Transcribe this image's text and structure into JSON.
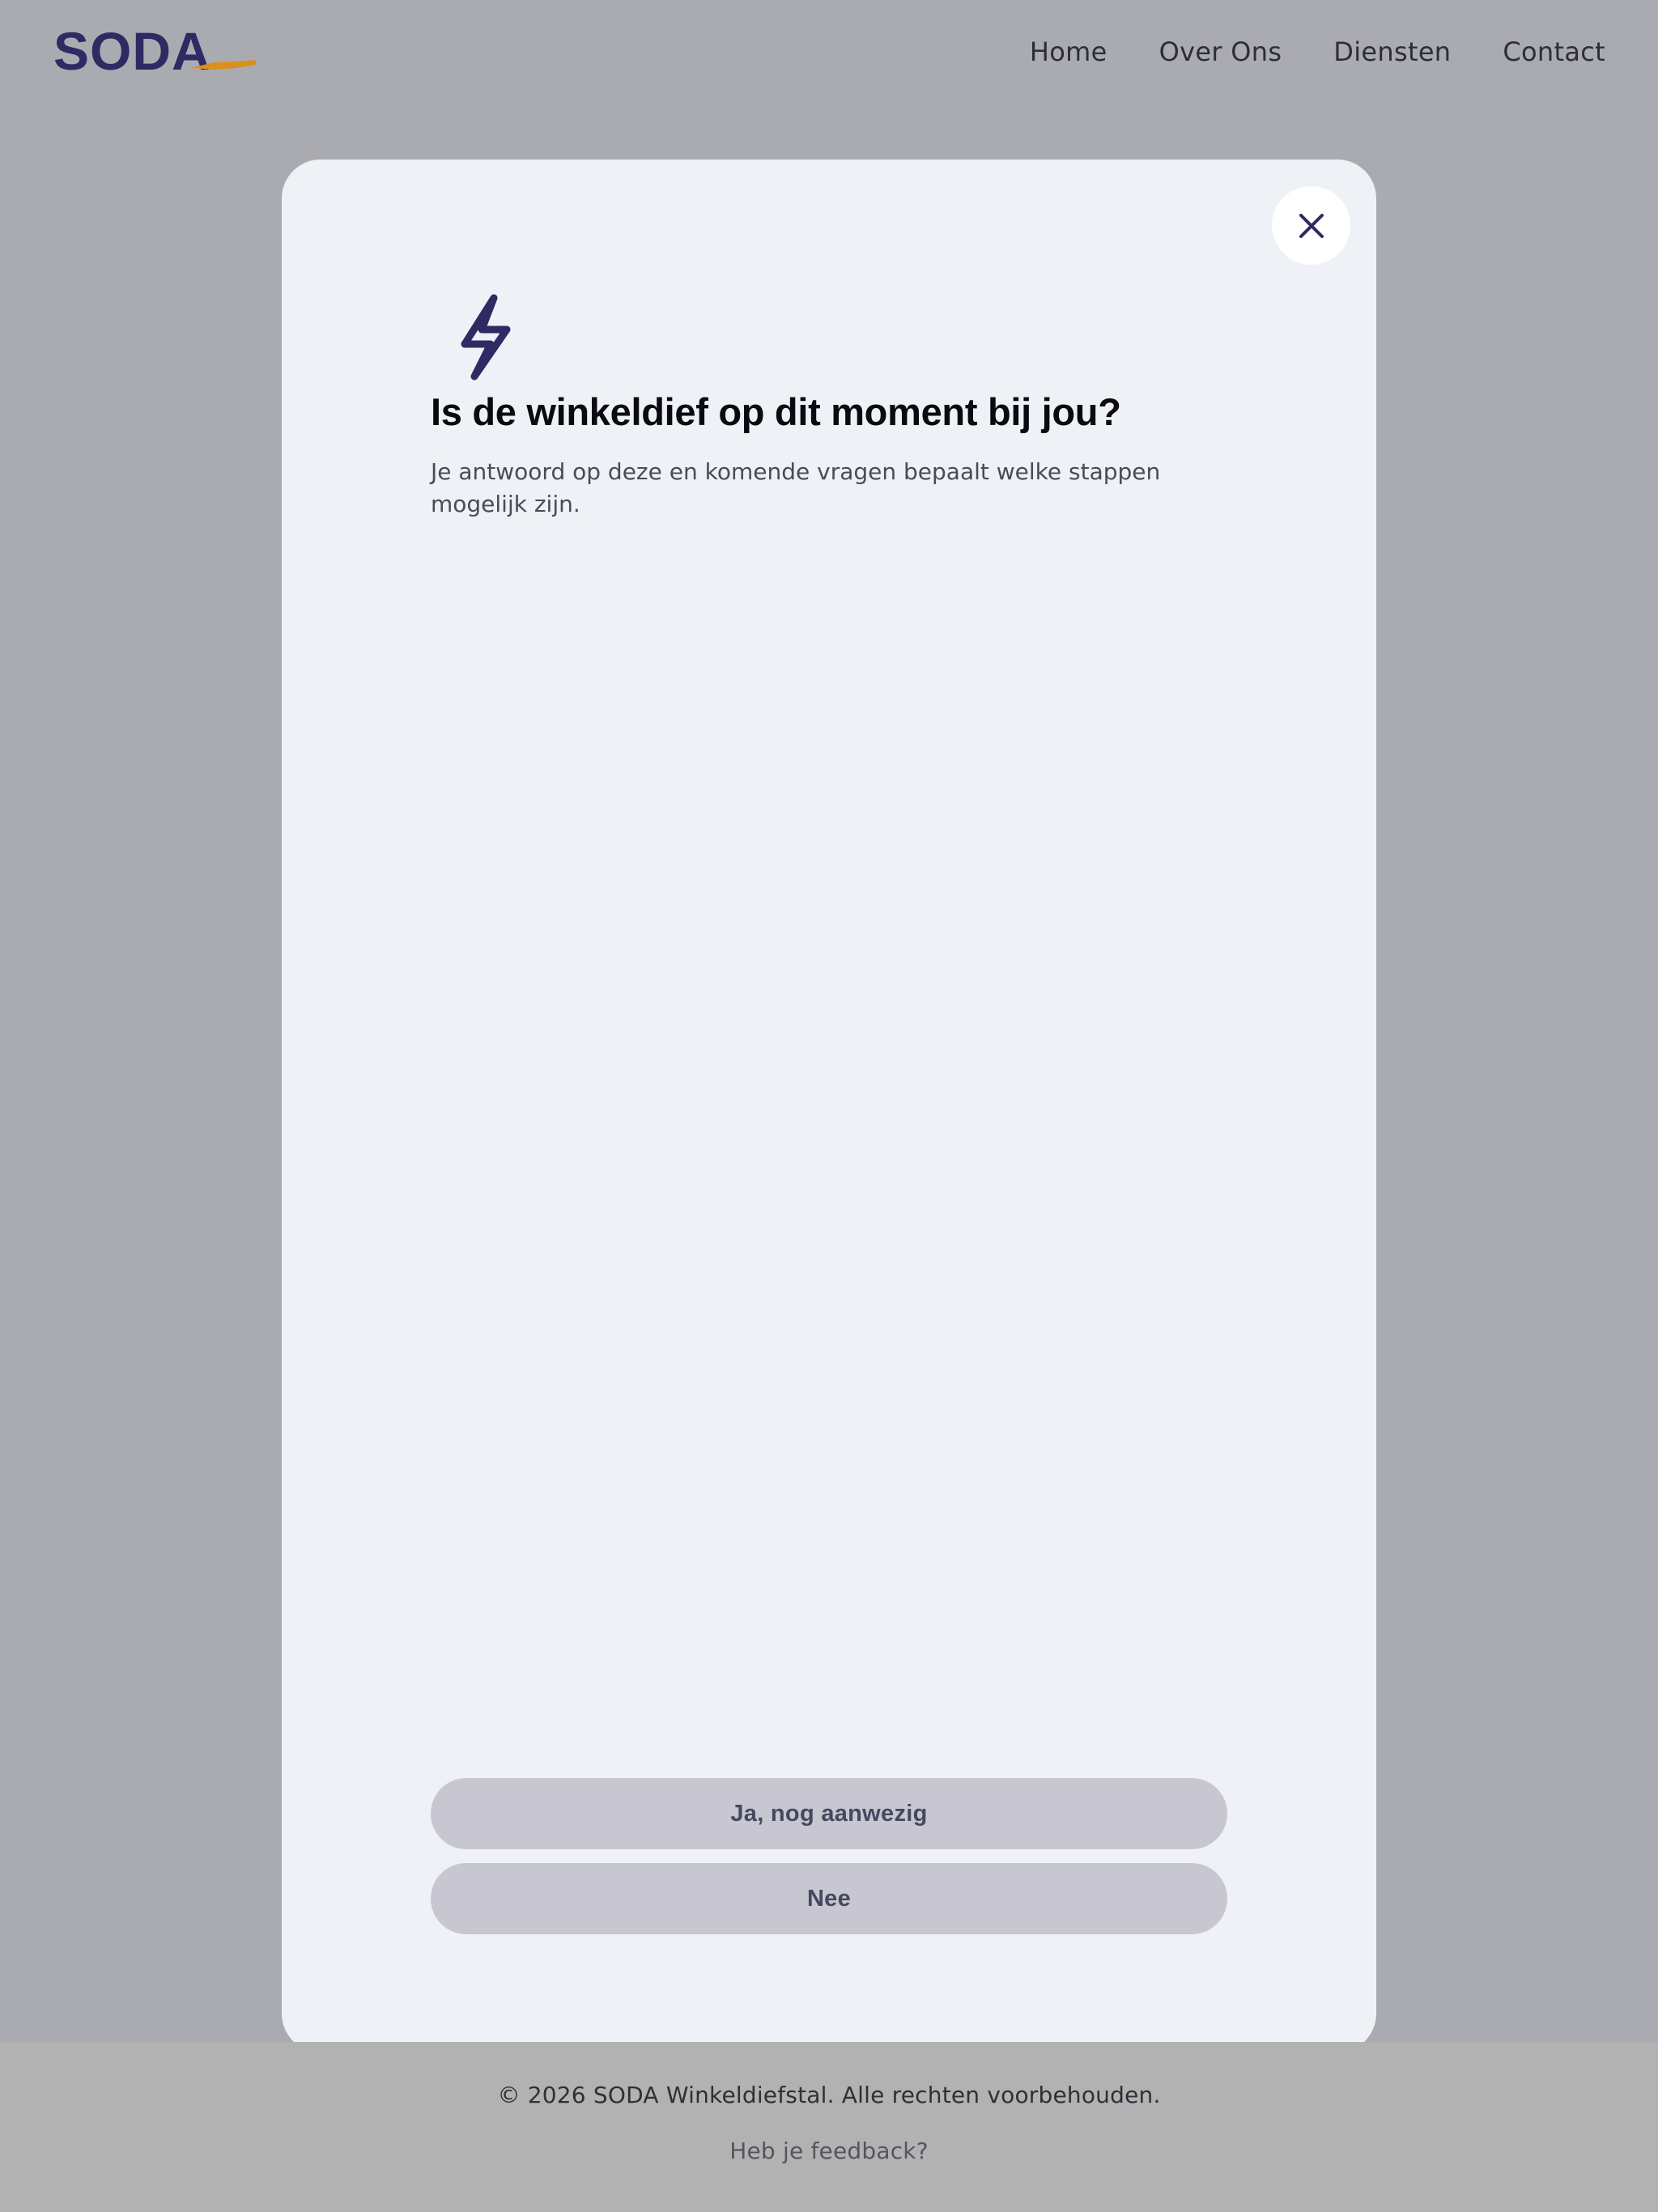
{
  "header": {
    "logo_text": "SODA",
    "nav": [
      "Home",
      "Over Ons",
      "Diensten",
      "Contact"
    ]
  },
  "modal": {
    "icon": "lightning-bolt-icon",
    "close_icon": "close-icon",
    "title": "Is de winkeldief op dit moment bij jou?",
    "description": "Je antwoord op deze en komende vragen bepaalt welke stappen mogelijk zijn.",
    "options": [
      "Ja, nog aanwezig",
      "Nee"
    ]
  },
  "footer": {
    "copyright": "© 2026 SODA Winkeldiefstal. Alle rechten voorbehouden.",
    "feedback": "Heb je feedback?"
  },
  "colors": {
    "brand": "#2e2a63",
    "accent": "#d9901c",
    "overlay_background": "#aaabb0",
    "modal_background": "#eef1f6",
    "button_background": "#c8c6d1"
  }
}
